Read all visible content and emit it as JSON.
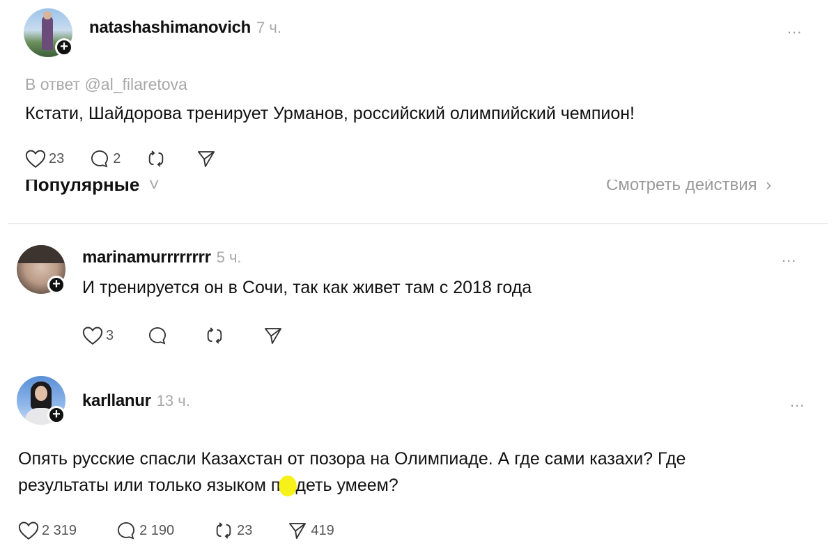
{
  "posts": [
    {
      "username": "natashashimanovich",
      "time": "7 ч.",
      "more": "...",
      "reply_to": "В ответ @al_filaretova",
      "text": "Кстати, Шайдорова тренирует Урманов, российский олимпийский чемпион!",
      "likes": "23",
      "replies": "2",
      "reposts": "",
      "shares": ""
    },
    {
      "username": "marinamurrrrrrrr",
      "time": "5 ч.",
      "more": "...",
      "text": "И тренируется он в Сочи, так как живет там с 2018 года",
      "likes": "3",
      "replies": "",
      "reposts": "",
      "shares": ""
    },
    {
      "username": "karllanur",
      "time": "13 ч.",
      "more": "...",
      "text_line1": "Опять русские спасли Казахстан от позора на Олимпиаде. А где сами казахи? Где",
      "text_line2_a": "результаты или только языком п",
      "text_line2_b": "деть умеем?",
      "likes": "2 319",
      "replies": "2 190",
      "reposts": "23",
      "shares": "419"
    }
  ],
  "separator": {
    "left": "Популярные",
    "left_caret": "˅",
    "right": "Смотреть действия",
    "right_chevron": "›"
  },
  "icons": {
    "like": "heart-icon",
    "reply": "comment-icon",
    "repost": "repost-icon",
    "share": "share-icon",
    "follow": "plus-icon"
  },
  "colors": {
    "highlight": "#f5f000",
    "muted": "#a9a9a9",
    "text": "#111111"
  }
}
